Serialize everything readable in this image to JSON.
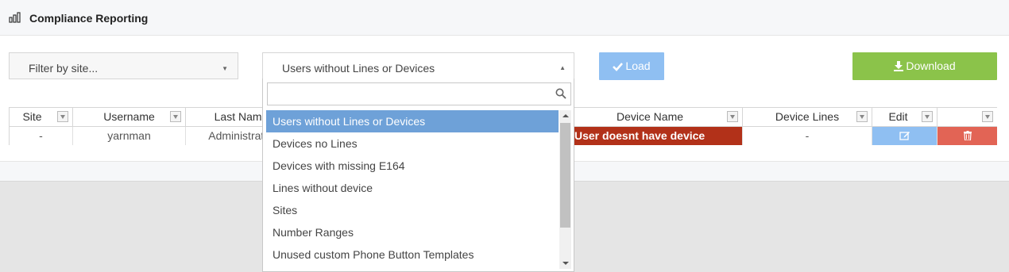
{
  "header": {
    "title": "Compliance Reporting",
    "icon": "bar-chart-icon"
  },
  "filters": {
    "site_placeholder": "Filter by site...",
    "report_selected": "Users without Lines or Devices"
  },
  "buttons": {
    "load": "Load",
    "download": "Download"
  },
  "dropdown": {
    "search_value": "",
    "options": [
      "Users without Lines or Devices",
      "Devices no Lines",
      "Devices with missing E164",
      "Lines without device",
      "Sites",
      "Number Ranges",
      "Unused custom Phone Button Templates"
    ],
    "selected_index": 0
  },
  "grid": {
    "columns": {
      "site": "Site",
      "username": "Username",
      "last_name": "Last Name",
      "device_name": "Device Name",
      "device_lines": "Device Lines",
      "edit": "Edit",
      "delete": ""
    },
    "row": {
      "site": "-",
      "username": "yarnman",
      "last_name": "Administrator",
      "device_name": "User doesnt have device",
      "device_lines": "-"
    }
  },
  "colors": {
    "load_button": "#8fbff2",
    "download_button": "#8bc34a",
    "no_device_cell": "#b23119",
    "edit_button": "#8fbff2",
    "delete_button": "#e26455",
    "selected_option": "#6ea1d8"
  }
}
